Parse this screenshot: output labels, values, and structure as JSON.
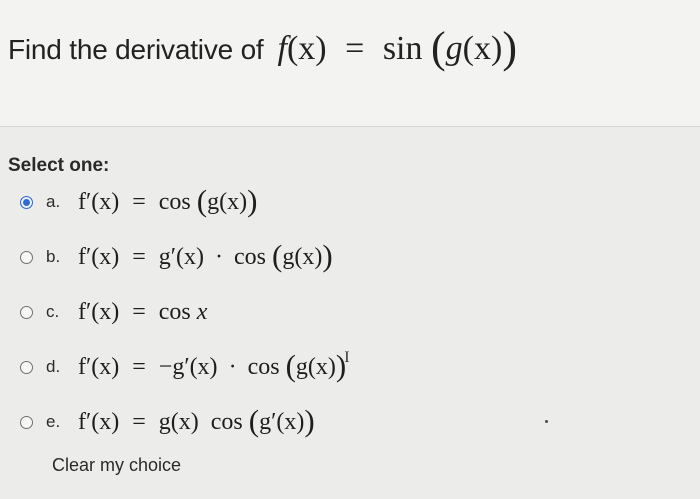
{
  "question": {
    "prefix": "Find the derivative of",
    "fn": "f",
    "arg": "(x)",
    "eq": "=",
    "sin": "sin",
    "inner_g": "g",
    "inner_x": "(x)"
  },
  "prompt": {
    "select_one": "Select one:"
  },
  "options": [
    {
      "letter": "a.",
      "expr": {
        "lhs": "f′(x)",
        "eq": "=",
        "rhs": "cos",
        "arg": "g(x)"
      },
      "selected": true
    },
    {
      "letter": "b.",
      "expr": {
        "lhs": "f′(x)",
        "eq": "=",
        "pre": "g′(x)",
        "dot": "·",
        "rhs": "cos",
        "arg": "g(x)"
      },
      "selected": false
    },
    {
      "letter": "c.",
      "expr": {
        "lhs": "f′(x)",
        "eq": "=",
        "rhs": "cos",
        "var": "x"
      },
      "selected": false
    },
    {
      "letter": "d.",
      "expr": {
        "lhs": "f′(x)",
        "eq": "=",
        "pre": "−g′(x)",
        "dot": "·",
        "rhs": "cos",
        "arg": "g(x)"
      },
      "selected": false
    },
    {
      "letter": "e.",
      "expr": {
        "lhs": "f′(x)",
        "eq": "=",
        "pre": "g(x)",
        "rhs": "cos",
        "arg": "g′(x)"
      },
      "selected": false
    }
  ],
  "clear_choice": "Clear my choice",
  "colors": {
    "radio_selected": "#2f6bd6",
    "background": "#eef0ee"
  }
}
